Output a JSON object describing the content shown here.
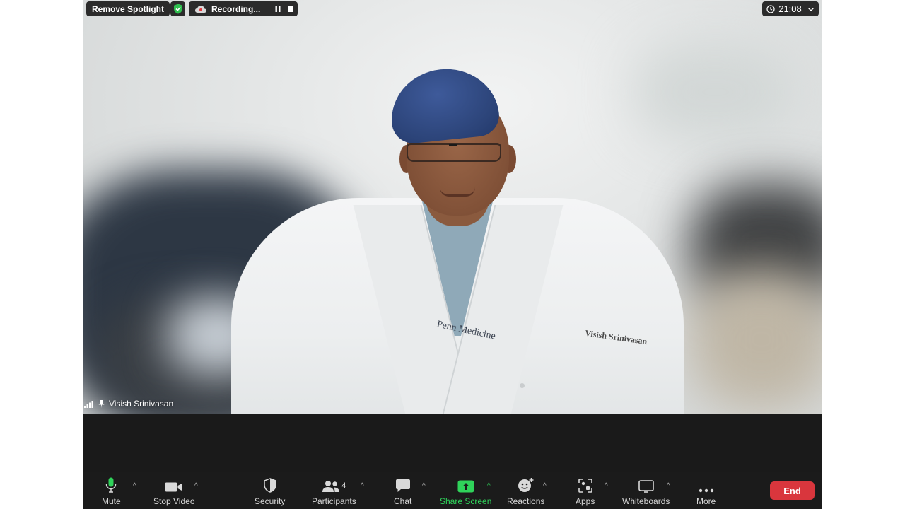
{
  "top_bar": {
    "remove_spotlight": "Remove Spotlight",
    "recording_label": "Recording...",
    "clock": "21:08"
  },
  "participant": {
    "name": "Visish Srinivasan",
    "coat_logo": "Penn Medicine",
    "coat_name": "Visish Srinivasan"
  },
  "toolbar": {
    "mute": "Mute",
    "stop_video": "Stop Video",
    "security": "Security",
    "participants": "Participants",
    "participants_count": "4",
    "chat": "Chat",
    "share_screen": "Share Screen",
    "reactions": "Reactions",
    "apps": "Apps",
    "whiteboards": "Whiteboards",
    "more": "More",
    "end": "End"
  },
  "icons": {
    "shield": "shield-check-icon",
    "cloud": "cloud-record-icon",
    "pause": "pause-icon",
    "stop": "stop-icon",
    "clock": "clock-icon",
    "chevron": "chevron-down-icon",
    "signal": "signal-bars-icon",
    "pin": "pin-icon",
    "microphone": "microphone-icon",
    "video": "video-camera-icon",
    "security": "security-shield-icon",
    "participants": "participants-icon",
    "chat": "chat-bubble-icon",
    "share": "share-screen-icon",
    "reactions": "emoji-plus-icon",
    "apps": "apps-icon",
    "whiteboards": "whiteboard-icon",
    "more": "more-dots-icon"
  },
  "colors": {
    "end_button": "#d9363d",
    "share_green": "#2fd35a",
    "mic_green": "#2fd35a",
    "shield_green": "#2fbf4f",
    "toolbar_bg": "#1b1b1b"
  }
}
